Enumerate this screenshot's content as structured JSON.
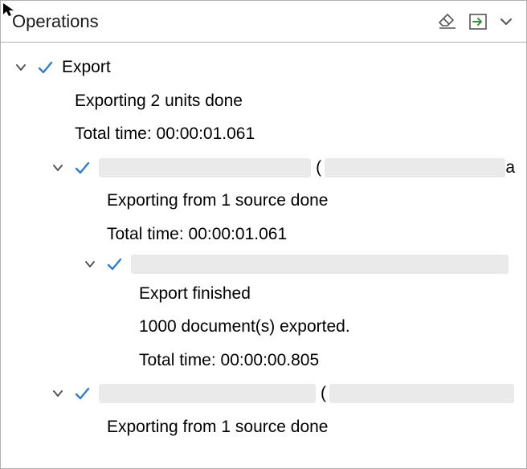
{
  "header": {
    "title": "Operations"
  },
  "tree": {
    "root": {
      "title": "Export",
      "status_line": "Exporting 2 units done",
      "time_line": "Total time: 00:00:01.061",
      "children": [
        {
          "status_line": "Exporting from 1 source done",
          "time_line": "Total time: 00:00:01.061",
          "paren": "(",
          "inner": {
            "line1": "Export finished",
            "line2": "1000 document(s) exported.",
            "line3": "Total time: 00:00:00.805"
          }
        },
        {
          "status_line": "Exporting from 1 source done",
          "paren": "("
        }
      ]
    }
  }
}
